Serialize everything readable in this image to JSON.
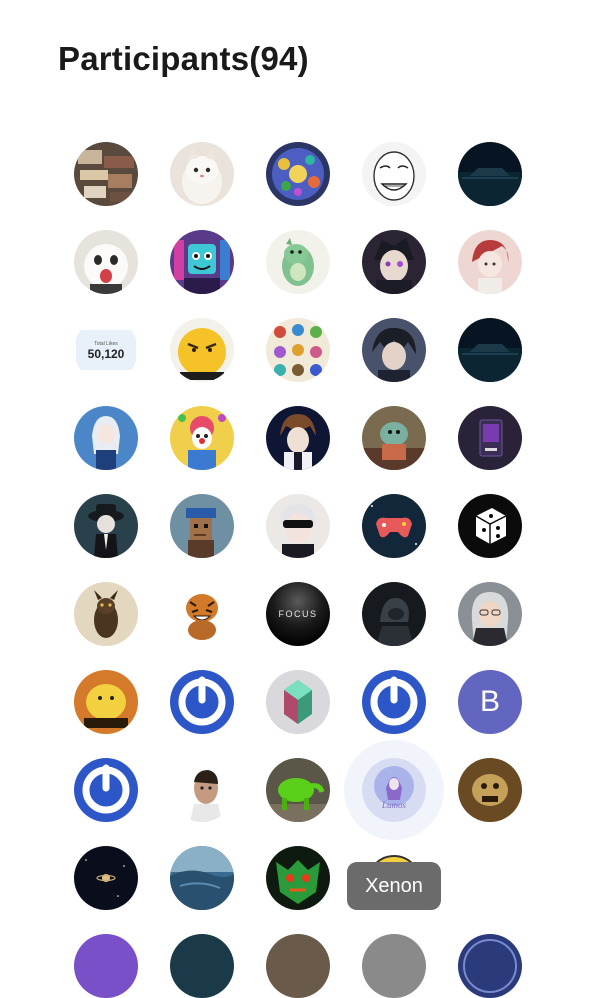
{
  "header": {
    "title": "Participants(94)"
  },
  "colors": {
    "brand_blue": "#2d57c9",
    "letter_avatar_bg": "#6366c0",
    "tooltip_bg": "#6b6b6b"
  },
  "tooltip": {
    "text": "Xenon"
  },
  "avatars": {
    "letter_b": "B",
    "focus_label": "FOCUS",
    "likes_label": "Total Likes",
    "likes_count": "50,120"
  }
}
